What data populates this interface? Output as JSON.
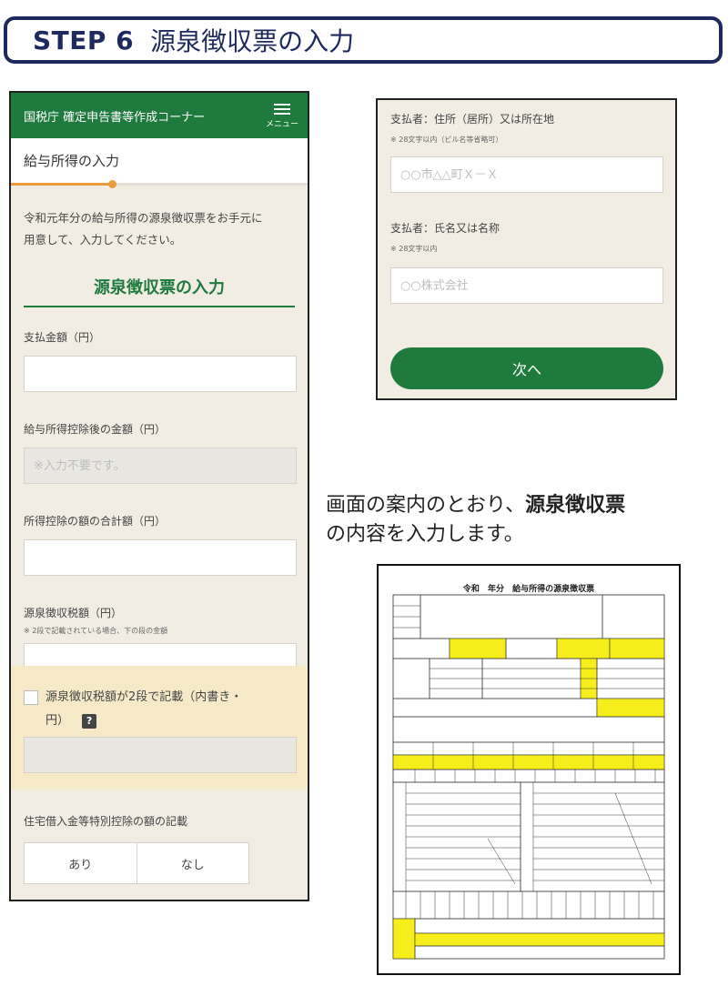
{
  "banner": {
    "step": "STEP 6",
    "title": "源泉徴収票の入力"
  },
  "left_phone": {
    "header_title": "国税庁 確定申告書等作成コーナー",
    "menu_label": "メニュー",
    "section_title": "給与所得の入力",
    "progress_fraction": 0.34,
    "intro_text_line1": "令和元年分の給与所得の源泉徴収票をお手元に",
    "intro_text_line2": "用意して、入力してください。",
    "form_heading": "源泉徴収票の入力",
    "fields": {
      "payment_amount_label": "支払金額（円）",
      "after_deduction_label": "給与所得控除後の金額（円）",
      "after_deduction_placeholder": "※入力不要です。",
      "deduction_total_label": "所得控除の額の合計額（円）",
      "withholding_tax_label": "源泉徴収税額（円）",
      "withholding_tax_note": "※ 2段で記載されている場合、下の段の金額"
    },
    "checkbox_label_line1": "源泉徴収税額が2段で記載（内書き・",
    "checkbox_label_line2": "円）",
    "help_badge": "?",
    "housing_loan_label": "住宅借入金等特別控除の額の記載",
    "toggle_yes": "あり",
    "toggle_no": "なし"
  },
  "right_phone": {
    "payer_address_label": "支払者：住所（居所）又は所在地",
    "payer_address_note": "※ 28文字以内（ビル名等省略可）",
    "payer_address_placeholder": "○○市△△町Ｘ－Ｘ",
    "payer_name_label": "支払者：氏名又は名称",
    "payer_name_note": "※ 28文字以内",
    "payer_name_placeholder": "○○株式会社",
    "next_button": "次へ"
  },
  "caption": {
    "line1_prefix": "画面の案内のとおり、",
    "line1_bold": "源泉徴収票",
    "line2": "の内容を入力します。"
  },
  "slip": {
    "title_era": "令和",
    "title_year": "年分",
    "title_text": "給与所得の源泉徴収票",
    "highlight_color": "#f5ee1a"
  },
  "colors": {
    "brand_green": "#1f7a3e",
    "banner_navy": "#1e2a5e",
    "progress_orange": "#e89b3a",
    "panel_beige": "#f1ede3",
    "checkbox_area": "#f5e9c8"
  }
}
